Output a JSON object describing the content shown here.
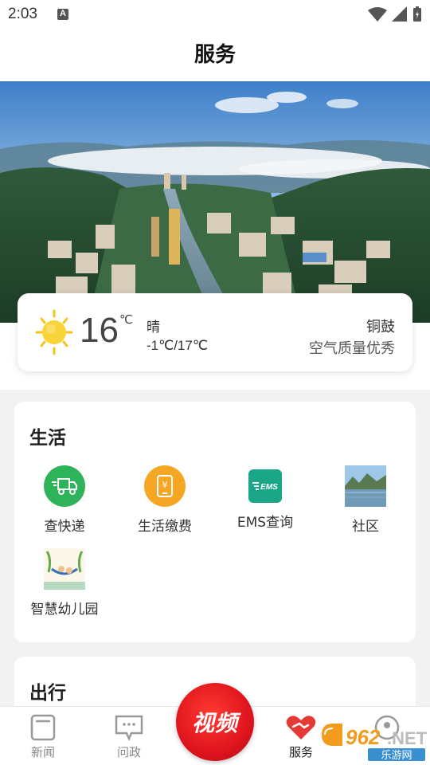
{
  "status_bar": {
    "time": "2:03"
  },
  "header": {
    "title": "服务"
  },
  "weather": {
    "temperature": "16",
    "unit": "℃",
    "condition": "晴",
    "range": "-1℃/17℃",
    "city": "铜鼓",
    "air_quality": "空气质量优秀",
    "icon": "sun-icon"
  },
  "sections": {
    "life": {
      "title": "生活",
      "items": [
        {
          "label": "查快递",
          "icon": "delivery-truck-icon",
          "color": "#2fb35a"
        },
        {
          "label": "生活缴费",
          "icon": "bill-payment-icon",
          "color": "#f5a623"
        },
        {
          "label": "EMS查询",
          "icon": "ems-icon",
          "color": "#1aa687"
        },
        {
          "label": "社区",
          "icon": "community-photo-icon"
        },
        {
          "label": "智慧幼儿园",
          "icon": "kindergarten-icon"
        }
      ]
    },
    "travel": {
      "title": "出行"
    }
  },
  "tabbar": {
    "tabs": [
      {
        "label": "新闻",
        "icon": "news-icon",
        "active": false
      },
      {
        "label": "问政",
        "icon": "chat-icon",
        "active": false
      },
      {
        "label": "视频",
        "icon": "video-icon",
        "active": false
      },
      {
        "label": "服务",
        "icon": "heart-handshake-icon",
        "active": true
      },
      {
        "label": "",
        "icon": "profile-icon",
        "active": false
      }
    ]
  },
  "watermark": {
    "text": "962.NET",
    "subtext": "乐游网"
  },
  "colors": {
    "accent_red": "#e0141e",
    "active_tab": "#e53935"
  }
}
